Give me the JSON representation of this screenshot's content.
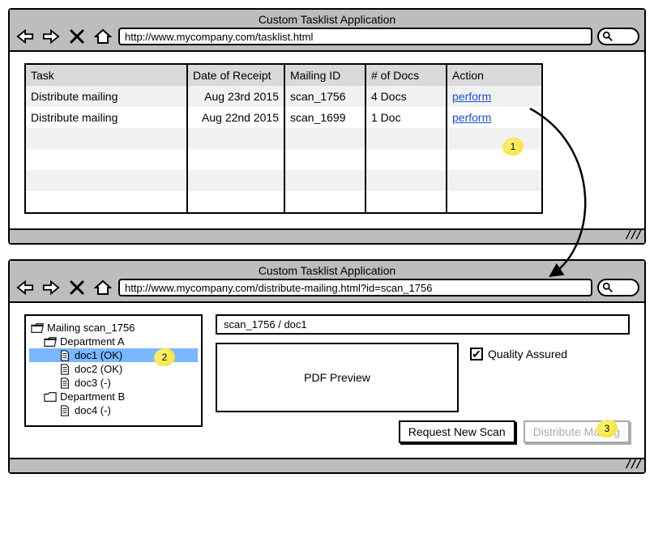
{
  "window1": {
    "title": "Custom Tasklist Application",
    "url": "http://www.mycompany.com/tasklist.html",
    "table": {
      "headers": [
        "Task",
        "Date of Receipt",
        "Mailing ID",
        "# of Docs",
        "Action"
      ],
      "rows": [
        {
          "task": "Distribute mailing",
          "date": "Aug 23rd 2015",
          "mailing_id": "scan_1756",
          "docs": "4 Docs",
          "action": "perform"
        },
        {
          "task": "Distribute mailing",
          "date": "Aug 22nd 2015",
          "mailing_id": "scan_1699",
          "docs": "1 Doc",
          "action": "perform"
        }
      ]
    }
  },
  "window2": {
    "title": "Custom Tasklist Application",
    "url": "http://www.mycompany.com/distribute-mailing.html?id=scan_1756",
    "tree": {
      "root": "Mailing scan_1756",
      "deptA": "Department A",
      "doc1": "doc1 (OK)",
      "doc2": "doc2 (OK)",
      "doc3": "doc3 (-)",
      "deptB": "Department B",
      "doc4": "doc4 (-)"
    },
    "breadcrumb": "scan_1756 / doc1",
    "pdf_preview_label": "PDF Preview",
    "quality_assured_label": "Quality Assured",
    "quality_assured_checked": true,
    "buttons": {
      "request_new_scan": "Request New Scan",
      "distribute_mailing": "Distribute Mailing"
    }
  },
  "annotations": {
    "a1": "1",
    "a2": "2",
    "a3": "3"
  }
}
